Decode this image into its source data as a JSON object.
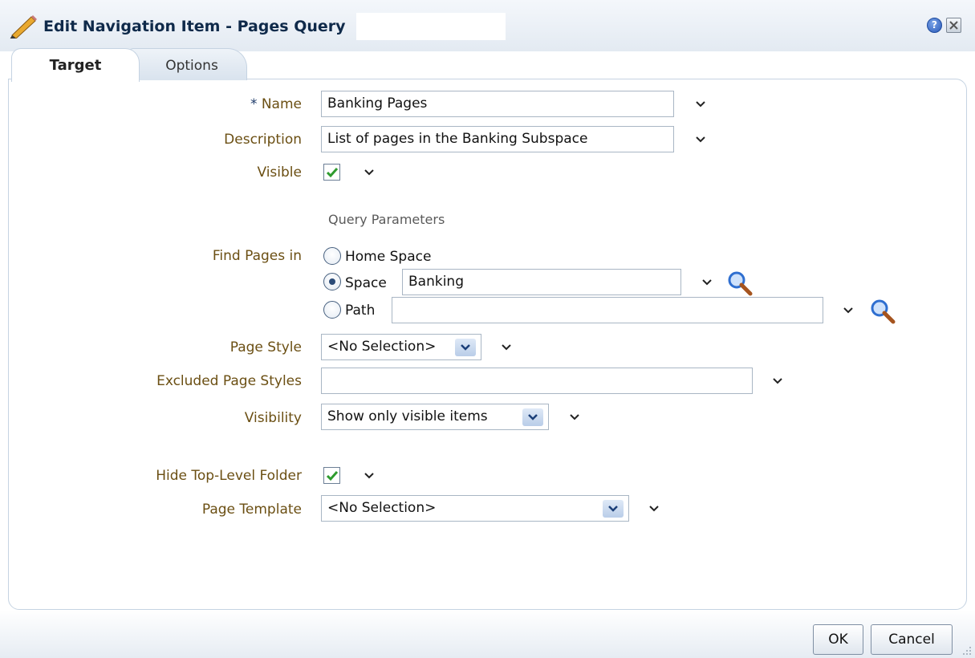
{
  "dialog": {
    "title": "Edit Navigation Item - Pages Query",
    "help_symbol": "?"
  },
  "tabs": [
    {
      "label": "Target",
      "selected": true
    },
    {
      "label": "Options",
      "selected": false
    }
  ],
  "form": {
    "name": {
      "required_mark": "*",
      "label": "Name",
      "value": "Banking Pages"
    },
    "description": {
      "label": "Description",
      "value": "List of pages in the Banking Subspace"
    },
    "visible": {
      "label": "Visible",
      "checked": true
    },
    "query_heading": "Query Parameters",
    "find_pages_in": {
      "label": "Find Pages in",
      "options": [
        {
          "label": "Home Space",
          "selected": false
        },
        {
          "label": "Space",
          "selected": true,
          "value": "Banking"
        },
        {
          "label": "Path",
          "selected": false,
          "value": ""
        }
      ]
    },
    "page_style": {
      "label": "Page Style",
      "value": "<No Selection>"
    },
    "excluded_page_styles": {
      "label": "Excluded Page Styles",
      "value": ""
    },
    "visibility": {
      "label": "Visibility",
      "value": "Show only visible items"
    },
    "hide_top_level_folder": {
      "label": "Hide Top-Level Folder",
      "checked": true
    },
    "page_template": {
      "label": "Page Template",
      "value": "<No Selection>"
    }
  },
  "buttons": {
    "ok": "OK",
    "cancel": "Cancel"
  },
  "colors": {
    "label_text": "#6b4f13",
    "title_text": "#0f2a4a",
    "checkmark": "#2e9b2e",
    "panel_border": "#c5d3e2"
  },
  "icons": [
    "pencil-icon",
    "help-icon",
    "close-icon",
    "chevron-down-icon",
    "checkmark-icon",
    "search-icon"
  ]
}
